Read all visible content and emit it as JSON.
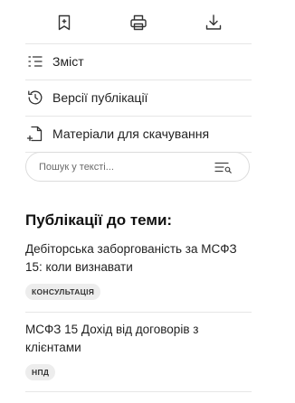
{
  "toolbar": {
    "icons": [
      "bookmark-icon",
      "print-icon",
      "download-icon"
    ]
  },
  "menu": {
    "items": [
      {
        "label": "Зміст",
        "icon": "list-icon"
      },
      {
        "label": "Версії публікації",
        "icon": "history-icon"
      },
      {
        "label": "Матеріали для скачування",
        "icon": "file-add-icon"
      }
    ]
  },
  "search": {
    "placeholder": "Пошук у тексті...",
    "icon": "text-search-icon"
  },
  "related": {
    "heading": "Публікації до теми:",
    "items": [
      {
        "title": "Дебіторська заборгованість за МСФЗ 15: коли визнавати",
        "badge": "КОНСУЛЬТАЦІЯ"
      },
      {
        "title": "МСФЗ 15 Дохід від договорів з клієнтами",
        "badge": "НПД"
      }
    ]
  }
}
